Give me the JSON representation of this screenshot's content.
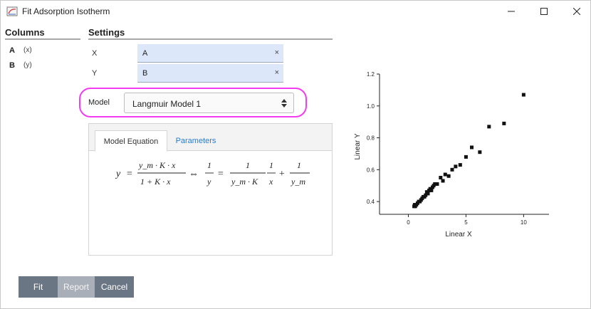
{
  "window": {
    "title": "Fit Adsorption Isotherm",
    "controls": [
      "minimize-icon",
      "maximize-icon",
      "close-icon"
    ]
  },
  "columns": {
    "header": "Columns",
    "items": [
      {
        "name": "A",
        "desc": "(x)"
      },
      {
        "name": "B",
        "desc": "(y)"
      }
    ]
  },
  "settings": {
    "header": "Settings",
    "x": {
      "label": "X",
      "value": "A",
      "clear": "×"
    },
    "y": {
      "label": "Y",
      "value": "B",
      "clear": "×"
    },
    "model": {
      "label": "Model",
      "value": "Langmuir Model 1"
    }
  },
  "tabs": {
    "active": "Model Equation",
    "inactive": "Parameters"
  },
  "equation": {
    "lhs1": "y",
    "num1": "y_m · K · x",
    "den1": "1 + K · x",
    "iff": "⇔",
    "num2": "1",
    "den2": "y",
    "num3": "1",
    "den3": "y_m · K",
    "num4": "1",
    "den4": "x",
    "plus": "+",
    "num5": "1",
    "den5": "y_m"
  },
  "buttons": {
    "fit": "Fit",
    "report": "Report",
    "cancel": "Cancel"
  },
  "colors": {
    "highlight": "#f23cf0",
    "field_bg": "#dce8fa",
    "button_dark": "#6b7684",
    "button_light": "#a9afb8",
    "tab_link": "#2a7bd4"
  },
  "chart_data": {
    "type": "scatter",
    "xlabel": "Linear X",
    "ylabel": "Linear Y",
    "xlim": [
      -2.5,
      12.2
    ],
    "ylim": [
      0.32,
      1.2
    ],
    "xticks": [
      0,
      5,
      10
    ],
    "yticks": [
      0.4,
      0.6,
      0.8,
      1.0,
      1.2
    ],
    "xtick_labels": [
      "0",
      "5",
      "10"
    ],
    "ytick_labels": [
      "0.4",
      "0.6",
      "0.8",
      "1.0",
      "1.2"
    ],
    "series": [
      {
        "x": [
          0.5,
          0.55,
          0.6,
          0.7,
          0.8,
          0.9,
          1.0,
          1.1,
          1.2,
          1.3,
          1.4,
          1.5,
          1.6,
          1.7,
          1.8,
          1.9,
          2.0,
          2.1,
          2.2,
          2.3,
          2.5,
          2.8,
          3.0,
          3.2,
          3.5,
          3.8,
          4.1,
          4.5,
          5.0,
          5.5,
          6.2,
          7.0,
          8.3,
          10.0
        ],
        "y": [
          0.37,
          0.38,
          0.37,
          0.38,
          0.39,
          0.4,
          0.4,
          0.41,
          0.42,
          0.43,
          0.43,
          0.44,
          0.46,
          0.45,
          0.47,
          0.48,
          0.47,
          0.49,
          0.5,
          0.51,
          0.51,
          0.55,
          0.53,
          0.57,
          0.56,
          0.6,
          0.62,
          0.63,
          0.68,
          0.74,
          0.71,
          0.87,
          0.89,
          1.07
        ]
      }
    ]
  }
}
